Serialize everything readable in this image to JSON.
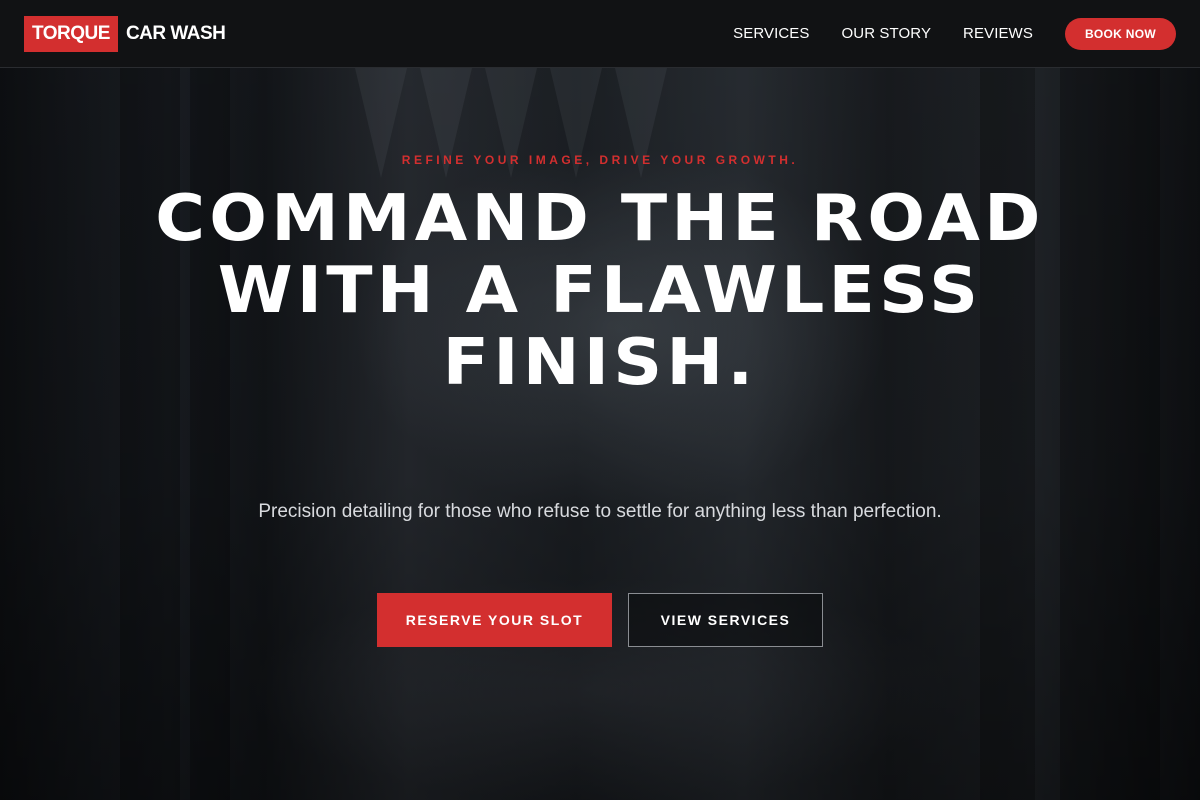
{
  "header": {
    "brand": {
      "primary": "TORQUE",
      "secondary": "CAR WASH"
    },
    "nav": [
      {
        "label": "SERVICES"
      },
      {
        "label": "OUR STORY"
      },
      {
        "label": "REVIEWS"
      }
    ],
    "cta_label": "BOOK NOW"
  },
  "hero": {
    "eyebrow": "REFINE YOUR IMAGE, DRIVE YOUR GROWTH.",
    "headline": "COMMAND THE ROAD WITH A FLAWLESS FINISH.",
    "subtext": "Precision detailing for those who refuse to settle for anything less than perfection.",
    "primary_cta": "RESERVE YOUR SLOT",
    "secondary_cta": "VIEW SERVICES"
  },
  "colors": {
    "accent": "#d32f2f",
    "header_bg": "#111214",
    "text": "#ffffff",
    "subtext": "#d8dade"
  }
}
